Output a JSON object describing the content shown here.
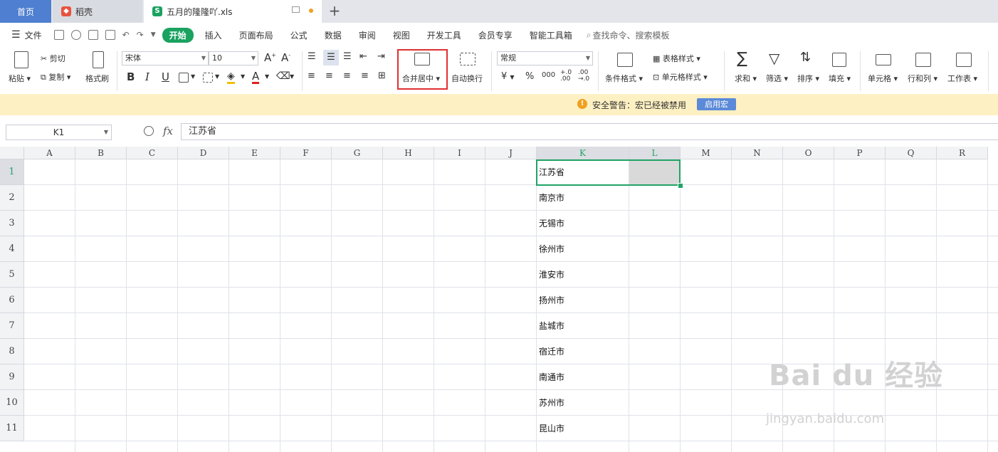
{
  "tabs": {
    "home": "首页",
    "daoke": "稻壳",
    "file": "五月的隆隆吖.xls"
  },
  "menu": {
    "file": "文件",
    "items": [
      "开始",
      "插入",
      "页面布局",
      "公式",
      "数据",
      "审阅",
      "视图",
      "开发工具",
      "会员专享",
      "智能工具箱"
    ],
    "search": "查找命令、搜索模板"
  },
  "ribbon": {
    "paste": "粘贴",
    "cut": "剪切",
    "copy": "复制",
    "format_painter": "格式刷",
    "font_name": "宋体",
    "font_size": "10",
    "merge_center": "合并居中",
    "wrap_text": "自动换行",
    "number_format": "常规",
    "currency": "¥",
    "percent": "%",
    "thousands": "000",
    "conditional_format": "条件格式",
    "table_style": "表格样式",
    "cell_style": "单元格样式",
    "sum": "求和",
    "filter": "筛选",
    "sort": "排序",
    "fill": "填充",
    "cells": "单元格",
    "rows_cols": "行和列",
    "worksheet": "工作表"
  },
  "warning": {
    "text": "安全警告：宏已经被禁用",
    "button": "启用宏"
  },
  "formula_bar": {
    "name_box": "K1",
    "fx": "fx",
    "value": "江苏省"
  },
  "columns": [
    "A",
    "B",
    "C",
    "D",
    "E",
    "F",
    "G",
    "H",
    "I",
    "J",
    "K",
    "L",
    "M",
    "N",
    "O",
    "P",
    "Q",
    "R"
  ],
  "rows": [
    "1",
    "2",
    "3",
    "4",
    "5",
    "6",
    "7",
    "8",
    "9",
    "10",
    "11"
  ],
  "column_k_values": [
    "江苏省",
    "南京市",
    "无锡市",
    "徐州市",
    "淮安市",
    "扬州市",
    "盐城市",
    "宿迁市",
    "南通市",
    "苏州市",
    "昆山市"
  ],
  "watermark": {
    "main": "Bai du 经验",
    "sub": "jingyan.baidu.com"
  },
  "colors": {
    "accent_green": "#21a366",
    "active_tab_blue": "#4e7fd0",
    "highlight_red": "#e03030",
    "warning_bg": "#fdf0c2"
  }
}
